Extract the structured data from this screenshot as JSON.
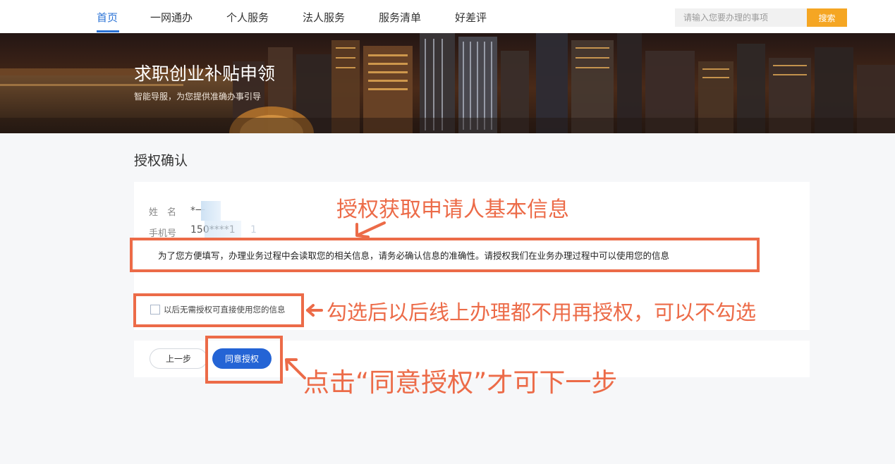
{
  "nav": {
    "items": [
      "首页",
      "一网通办",
      "个人服务",
      "法人服务",
      "服务清单",
      "好差评"
    ],
    "active_index": 0,
    "search_placeholder": "请输入您要办理的事项",
    "search_button": "搜索"
  },
  "banner": {
    "title": "求职创业补贴申领",
    "subtitle": "智能导服，为您提供准确办事引导"
  },
  "main": {
    "section_title": "授权确认",
    "fields": {
      "name_label": "姓　名",
      "name_value": "*一",
      "phone_label": "手机号",
      "phone_value": "150****1",
      "phone_tail": "1"
    },
    "notice": "为了您方便填写，办理业务过程中会读取您的相关信息，请务必确认信息的准确性。请授权我们在业务办理过程中可以使用您的信息",
    "checkbox_label": "以后无需授权可直接使用您的信息",
    "checkbox_checked": false,
    "buttons": {
      "prev": "上一步",
      "agree": "同意授权"
    }
  },
  "annotations": {
    "top": "授权获取申请人基本信息",
    "checkbox": "勾选后以后线上办理都不用再授权，可以不勾选",
    "button": "点击“同意授权”才可下一步"
  },
  "colors": {
    "accent": "#2b73d6",
    "search_button": "#f5a623",
    "agree_button": "#2464d5",
    "annotation": "#ec6b48"
  }
}
